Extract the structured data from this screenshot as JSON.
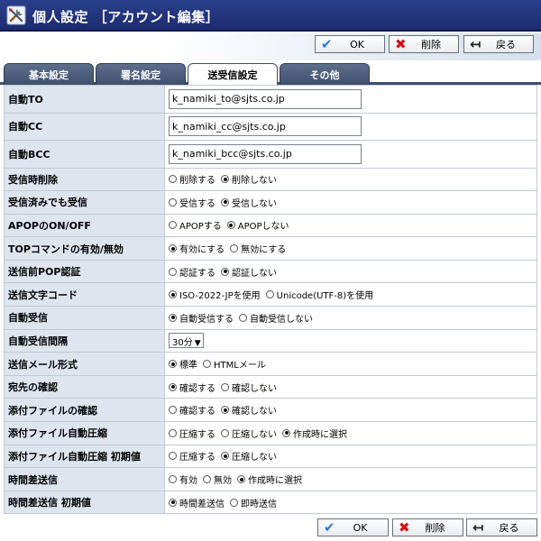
{
  "title": "個人設定 ［アカウント編集］",
  "buttons": {
    "ok": "OK",
    "delete": "削除",
    "back": "戻る"
  },
  "tabs": [
    {
      "label": "基本設定",
      "active": false
    },
    {
      "label": "署名設定",
      "active": false
    },
    {
      "label": "送受信設定",
      "active": true
    },
    {
      "label": "その他",
      "active": false
    }
  ],
  "fields": {
    "to": {
      "label": "自動TO",
      "value": "k_namiki_to@sjts.co.jp"
    },
    "cc": {
      "label": "自動CC",
      "value": "k_namiki_cc@sjts.co.jp"
    },
    "bcc": {
      "label": "自動BCC",
      "value": "k_namiki_bcc@sjts.co.jp"
    }
  },
  "rows": [
    {
      "label": "受信時削除",
      "options": [
        "削除する",
        "削除しない"
      ],
      "selected": 1
    },
    {
      "label": "受信済みでも受信",
      "options": [
        "受信する",
        "受信しない"
      ],
      "selected": 1
    },
    {
      "label": "APOPのON/OFF",
      "options": [
        "APOPする",
        "APOPしない"
      ],
      "selected": 1
    },
    {
      "label": "TOPコマンドの有効/無効",
      "options": [
        "有効にする",
        "無効にする"
      ],
      "selected": 0
    },
    {
      "label": "送信前POP認証",
      "options": [
        "認証する",
        "認証しない"
      ],
      "selected": 1
    },
    {
      "label": "送信文字コード",
      "options": [
        "ISO-2022-JPを使用",
        "Unicode(UTF-8)を使用"
      ],
      "selected": 0
    },
    {
      "label": "自動受信",
      "options": [
        "自動受信する",
        "自動受信しない"
      ],
      "selected": 0
    },
    {
      "label": "自動受信間隔",
      "select_value": "30分"
    },
    {
      "label": "送信メール形式",
      "options": [
        "標準",
        "HTMLメール"
      ],
      "selected": 0
    },
    {
      "label": "宛先の確認",
      "options": [
        "確認する",
        "確認しない"
      ],
      "selected": 0
    },
    {
      "label": "添付ファイルの確認",
      "options": [
        "確認する",
        "確認しない"
      ],
      "selected": 1
    },
    {
      "label": "添付ファイル自動圧縮",
      "options": [
        "圧縮する",
        "圧縮しない",
        "作成時に選択"
      ],
      "selected": 2
    },
    {
      "label": "添付ファイル自動圧縮 初期値",
      "options": [
        "圧縮する",
        "圧縮しない"
      ],
      "selected": 1
    },
    {
      "label": "時間差送信",
      "options": [
        "有効",
        "無効",
        "作成時に選択"
      ],
      "selected": 2
    },
    {
      "label": "時間差送信 初期値",
      "options": [
        "時間差送信",
        "即時送信"
      ],
      "selected": 0
    }
  ]
}
